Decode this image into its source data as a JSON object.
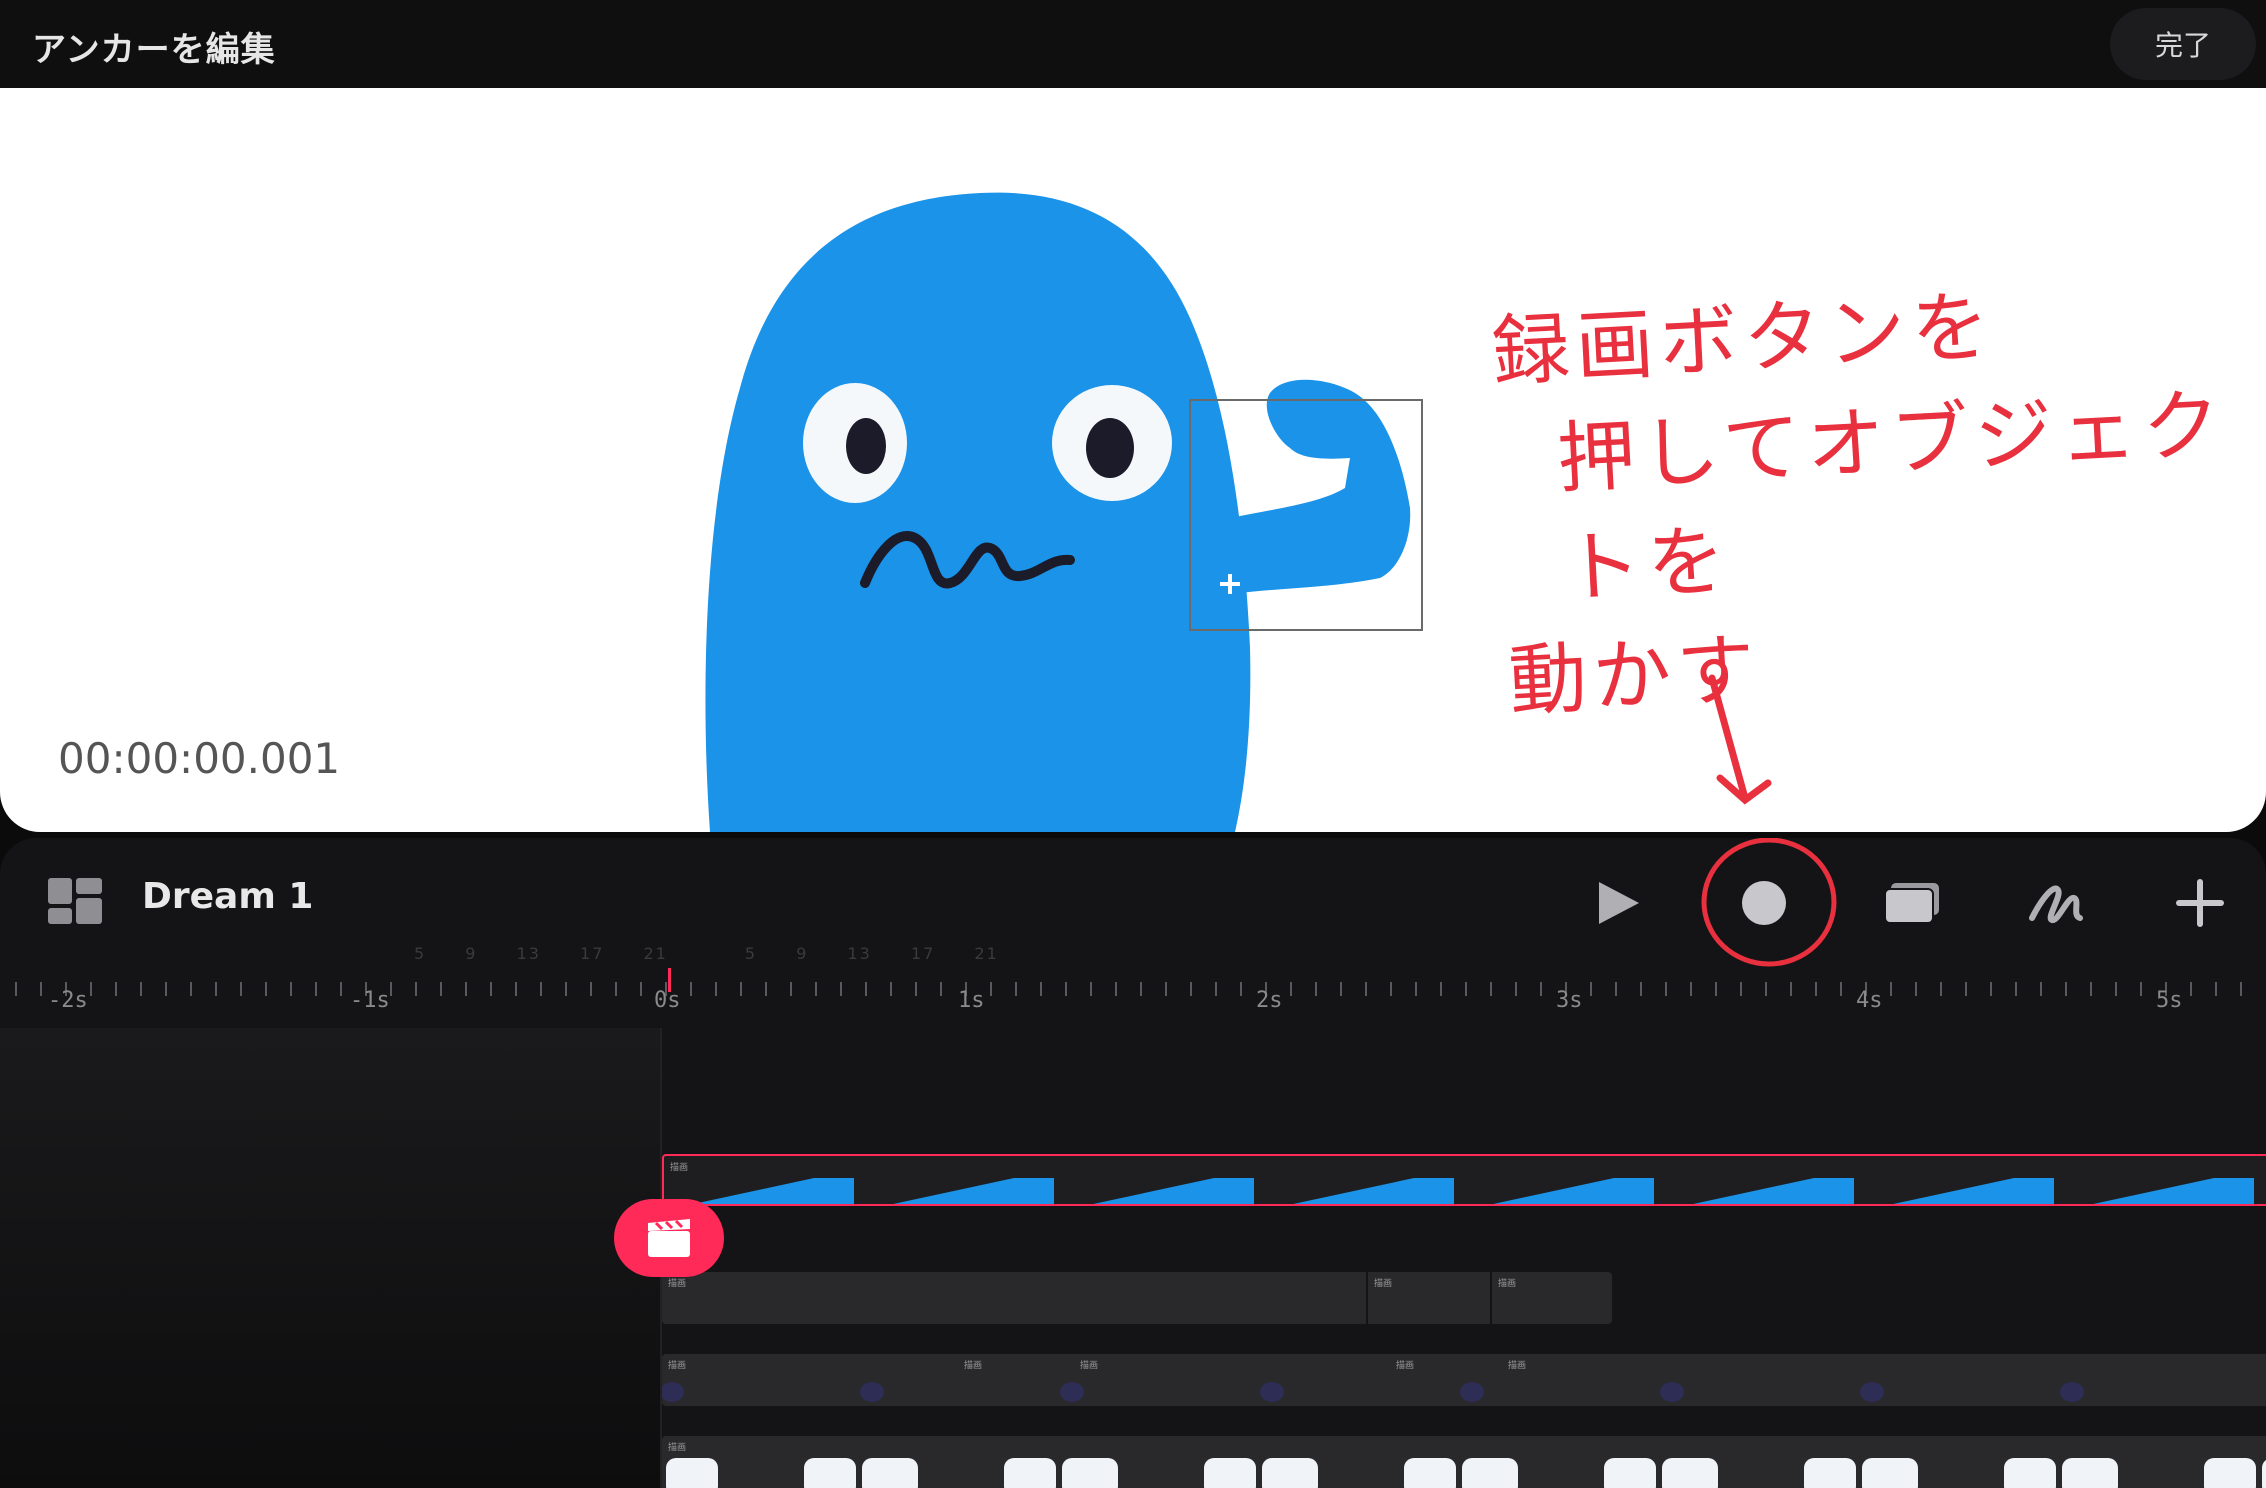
{
  "header": {
    "title": "アンカーを編集",
    "done_label": "完了"
  },
  "canvas": {
    "timecode": "00:00:00.001",
    "annotation_lines": [
      "録画ボタンを",
      "押してオブジェクトを",
      "動かす"
    ],
    "annotation_color": "#e8303e",
    "character_color": "#1a93e8"
  },
  "panel": {
    "project_name": "Dream 1",
    "tools": [
      {
        "name": "play-icon"
      },
      {
        "name": "record-icon"
      },
      {
        "name": "layers-icon"
      },
      {
        "name": "draw-icon"
      },
      {
        "name": "plus-icon"
      }
    ],
    "ruler": {
      "labels": [
        "-2s",
        "-1s",
        "0s",
        "1s",
        "2s",
        "3s",
        "4s",
        "5s"
      ],
      "faint_frames": [
        "5",
        "9",
        "13",
        "17",
        "21",
        "5",
        "9",
        "13",
        "17",
        "21"
      ]
    },
    "track_clip_label": "描画",
    "accent": "#ff2a58"
  }
}
